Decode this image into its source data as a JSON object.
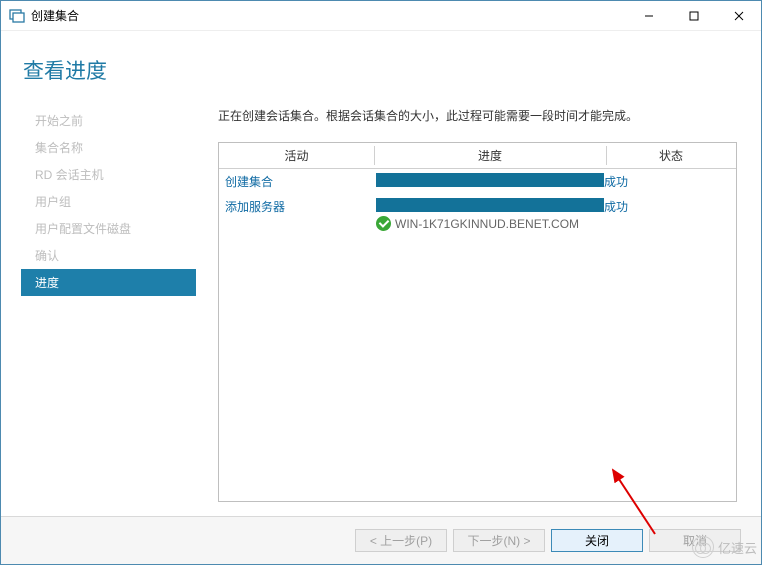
{
  "window": {
    "title": "创建集合"
  },
  "heading": "查看进度",
  "sidebar": {
    "items": [
      {
        "label": "开始之前"
      },
      {
        "label": "集合名称"
      },
      {
        "label": "RD 会话主机"
      },
      {
        "label": "用户组"
      },
      {
        "label": "用户配置文件磁盘"
      },
      {
        "label": "确认"
      },
      {
        "label": "进度"
      }
    ]
  },
  "content": {
    "description": "正在创建会话集合。根据会话集合的大小，此过程可能需要一段时间才能完成。",
    "headers": {
      "activity": "活动",
      "progress": "进度",
      "status": "状态"
    },
    "rows": [
      {
        "activity": "创建集合",
        "status": "成功",
        "server": ""
      },
      {
        "activity": "添加服务器",
        "status": "成功",
        "server": "WIN-1K71GKINNUD.BENET.COM"
      }
    ]
  },
  "footer": {
    "prev": "< 上一步(P)",
    "next": "下一步(N) >",
    "close": "关闭",
    "cancel": "取消"
  },
  "watermark": "亿速云"
}
